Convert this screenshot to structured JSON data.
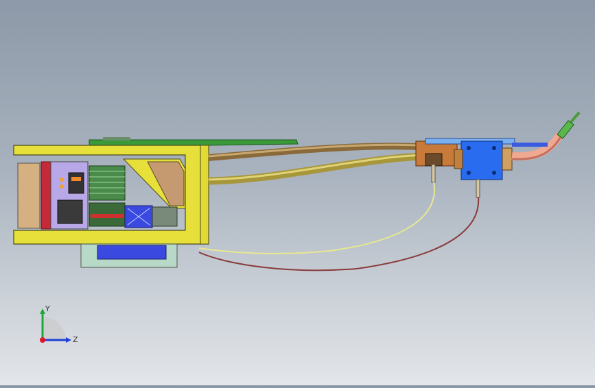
{
  "app": {
    "title": ""
  },
  "triad": {
    "y_label": "Y",
    "z_label": "Z",
    "y_axis_color": "#1fa83a",
    "z_axis_color": "#1f3fd6",
    "x_axis_color": "#e0142a"
  },
  "model": {
    "frame_color": "#e8e03a",
    "board_color": "#9ac848",
    "pcb_color": "#b8a8e8",
    "pump_color": "#2a6cf0",
    "hose_color": "#b8a13a",
    "elbow_color": "#f0a890",
    "wire_yellow": "#e8e890",
    "wire_red": "#8a3a3a"
  }
}
